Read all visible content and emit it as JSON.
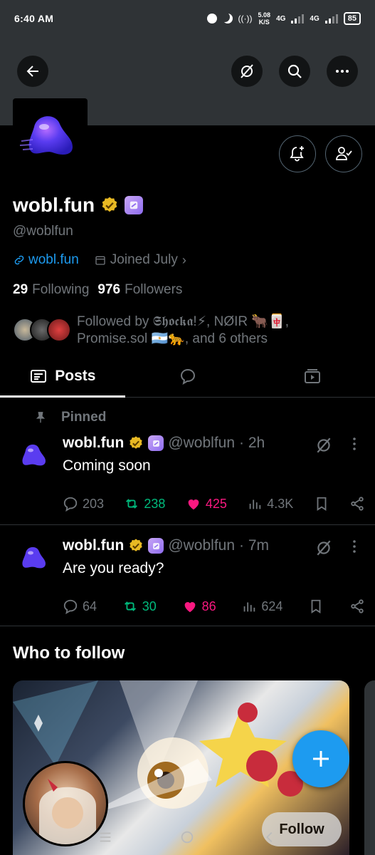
{
  "status_bar": {
    "time": "6:40 AM",
    "net_speed_value": "5.08",
    "net_speed_unit": "K/S",
    "network_1": "4G",
    "network_2": "4G",
    "battery": "85"
  },
  "profile": {
    "display_name": "wobl.fun",
    "handle": "@woblfun",
    "website": "wobl.fun",
    "joined": "Joined July",
    "following_count": "29",
    "following_label": "Following",
    "followers_count": "976",
    "followers_label": "Followers",
    "followed_by": "Followed by 𝕾𝖍𝖔𝖈𝖐𝖆!⚡, NØIR 🐂🀄, Promise.sol 🇦🇷🐆, and 6 others"
  },
  "tabs": [
    {
      "label": "Posts",
      "icon": "posts-icon",
      "active": true
    },
    {
      "label": "",
      "icon": "replies-icon",
      "active": false
    },
    {
      "label": "",
      "icon": "media-icon",
      "active": false
    }
  ],
  "pinned_label": "Pinned",
  "posts": [
    {
      "name": "wobl.fun",
      "handle": "@woblfun",
      "time": "· 2h",
      "text": "Coming soon",
      "replies": "203",
      "reposts": "238",
      "likes": "425",
      "views": "4.3K"
    },
    {
      "name": "wobl.fun",
      "handle": "@woblfun",
      "time": "· 7m",
      "text": "Are you ready?",
      "replies": "64",
      "reposts": "30",
      "likes": "86",
      "views": "624"
    }
  ],
  "who_to_follow": {
    "title": "Who to follow",
    "follow_label": "Follow"
  },
  "colors": {
    "accent": "#1d9bf0",
    "repost": "#00ba7c",
    "like": "#f91880",
    "muted": "#71767b",
    "verified_gold": "#e8b923"
  }
}
